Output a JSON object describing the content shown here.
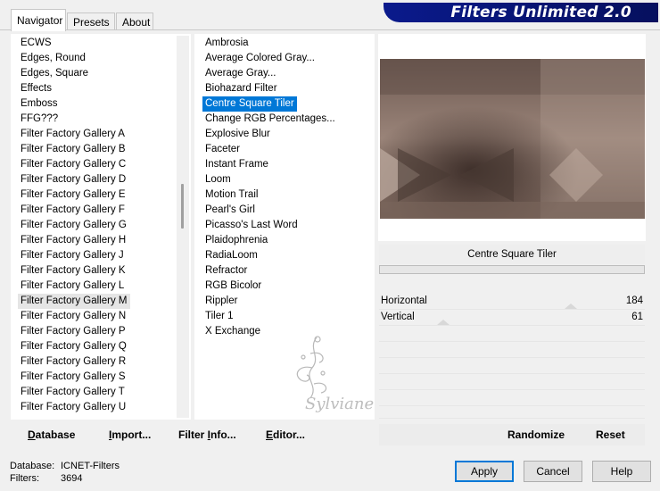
{
  "tabs": [
    {
      "label": "Navigator",
      "active": true
    },
    {
      "label": "Presets",
      "active": false
    },
    {
      "label": "About",
      "active": false
    }
  ],
  "banner": {
    "title": "Filters Unlimited 2.0"
  },
  "categories": [
    "ECWS",
    "Edges, Round",
    "Edges, Square",
    "Effects",
    "Emboss",
    "FFG???",
    "Filter Factory Gallery A",
    "Filter Factory Gallery B",
    "Filter Factory Gallery C",
    "Filter Factory Gallery D",
    "Filter Factory Gallery E",
    "Filter Factory Gallery F",
    "Filter Factory Gallery G",
    "Filter Factory Gallery H",
    "Filter Factory Gallery J",
    "Filter Factory Gallery K",
    "Filter Factory Gallery L",
    "Filter Factory Gallery M",
    "Filter Factory Gallery N",
    "Filter Factory Gallery P",
    "Filter Factory Gallery Q",
    "Filter Factory Gallery R",
    "Filter Factory Gallery S",
    "Filter Factory Gallery T",
    "Filter Factory Gallery U"
  ],
  "selected_category": "Filter Factory Gallery M",
  "filters": [
    "Ambrosia",
    "Average Colored Gray...",
    "Average Gray...",
    "Biohazard Filter",
    "Centre Square Tiler",
    "Change RGB Percentages...",
    "Explosive Blur",
    "Faceter",
    "Instant Frame",
    "Loom",
    "Motion Trail",
    "Pearl's Girl",
    "Picasso's Last Word",
    "Plaidophrenia",
    "RadiaLoom",
    "Refractor",
    "RGB Bicolor",
    "Rippler",
    "Tiler 1",
    "X Exchange"
  ],
  "selected_filter": "Centre Square Tiler",
  "preview": {
    "filter_name": "Centre Square Tiler"
  },
  "sliders": [
    {
      "label": "Horizontal",
      "value": "184",
      "fraction": 0.72
    },
    {
      "label": "Vertical",
      "value": "61",
      "fraction": 0.24
    }
  ],
  "left_buttons": [
    {
      "label": "Database",
      "underline": "D",
      "rest": "atabase"
    },
    {
      "label": "Import...",
      "underline": "I",
      "rest": "mport..."
    },
    {
      "label": "Filter Info...",
      "pre": "Filter ",
      "underline": "I",
      "rest": "nfo..."
    },
    {
      "label": "Editor...",
      "underline": "E",
      "rest": "ditor..."
    }
  ],
  "right_buttons": {
    "randomize": "Randomize",
    "reset": "Reset"
  },
  "status": {
    "database_label": "Database:",
    "database_value": "ICNET-Filters",
    "filters_label": "Filters:",
    "filters_value": "3694"
  },
  "dialog_buttons": {
    "apply": "Apply",
    "cancel": "Cancel",
    "help": "Help"
  },
  "watermark": {
    "text": "Sylviane"
  },
  "colors": {
    "accent": "#0078d7",
    "banner": "#0a1a8c",
    "preview_base": "#8f7a70"
  }
}
